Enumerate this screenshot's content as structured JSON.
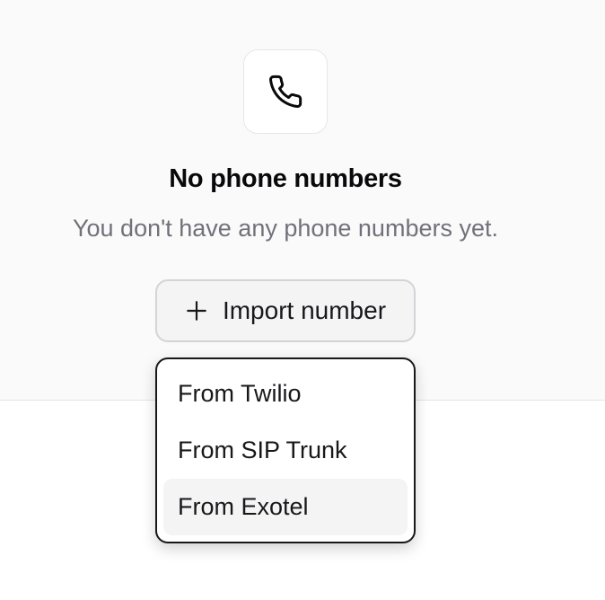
{
  "empty_state": {
    "icon": "phone-icon",
    "title": "No phone numbers",
    "subtitle": "You don't have any phone numbers yet."
  },
  "import_button": {
    "icon": "plus-icon",
    "label": "Import number"
  },
  "dropdown": {
    "items": [
      {
        "label": "From Twilio"
      },
      {
        "label": "From SIP Trunk"
      },
      {
        "label": "From Exotel"
      }
    ],
    "highlighted_index": 2
  }
}
